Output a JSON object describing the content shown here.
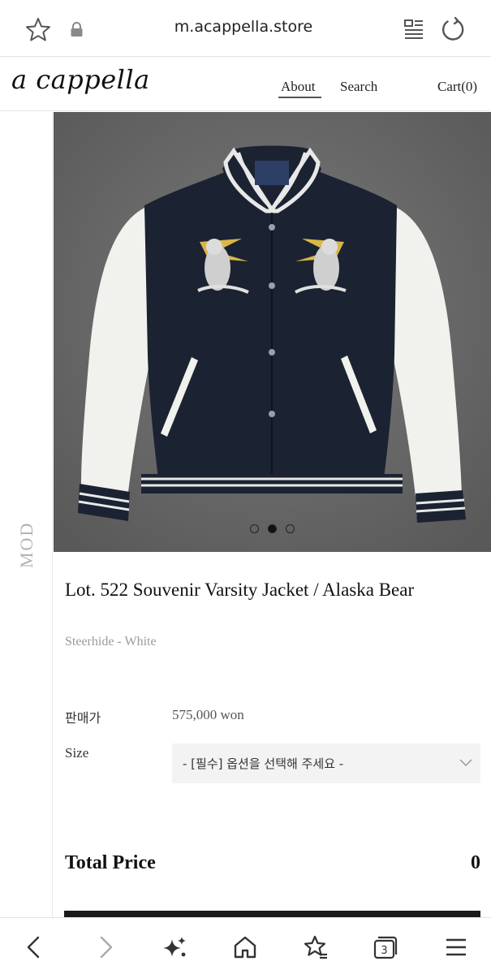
{
  "browser": {
    "url": "m.acappella.store",
    "tab_count": "3"
  },
  "site": {
    "logo": "a cappella",
    "nav": {
      "about": "About",
      "search": "Search",
      "cart": "Cart(0)"
    },
    "side_label": "MOD"
  },
  "product": {
    "title": "Lot. 522 Souvenir Varsity Jacket / Alaska Bear",
    "subtitle": "Steerhide - White",
    "price_label": "판매가",
    "price_value": "575,000 won",
    "size_label": "Size",
    "size_placeholder": "- [필수] 옵션을 선택해 주세요 -",
    "total_label": "Total Price",
    "total_value": "0",
    "gallery": {
      "count": 3,
      "active_index": 1
    }
  },
  "colors": {
    "accent": "#111111",
    "jacket_body": "#1a2233",
    "sleeve": "#f2f2f0",
    "background": "#6d6d6d"
  },
  "icons": {
    "favorite": "star-outline-icon",
    "secure": "lock-icon",
    "reader": "reader-mode-icon",
    "reload": "reload-icon",
    "back": "chevron-left-icon",
    "forward": "chevron-right-icon",
    "ai": "sparkle-icon",
    "home": "home-icon",
    "bookmarks": "bookmark-star-icon",
    "tabs": "tabs-icon",
    "menu": "hamburger-menu-icon"
  }
}
